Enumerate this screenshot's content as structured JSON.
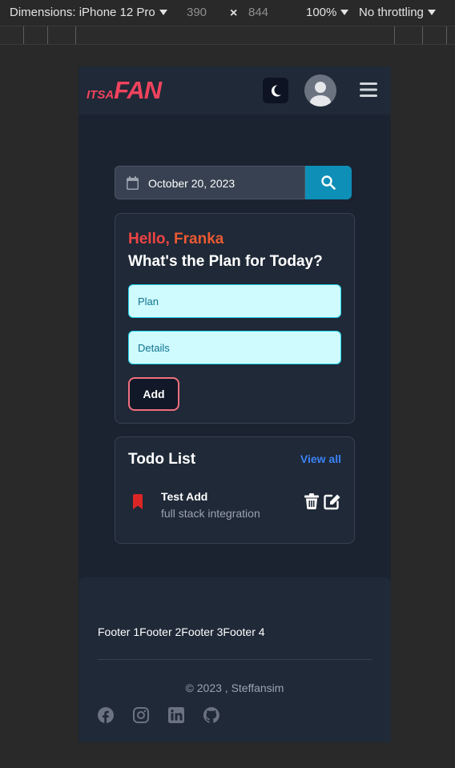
{
  "devtools": {
    "dimensions_label": "Dimensions: iPhone 12 Pro",
    "width": "390",
    "height": "844",
    "zoom": "100%",
    "throttling": "No throttling"
  },
  "navbar": {
    "logo_small": "ITSA",
    "logo_big": "FAN",
    "colors": {
      "brand": "#f0435e"
    }
  },
  "search": {
    "date_value": "October 20, 2023"
  },
  "plan_card": {
    "hello": "Hello,",
    "name": "Franka",
    "title": "What's the Plan for Today?",
    "plan_placeholder": "Plan",
    "details_placeholder": "Details",
    "add_label": "Add"
  },
  "todo": {
    "title": "Todo List",
    "view_all": "View all",
    "items": [
      {
        "title": "Test Add",
        "subtitle": "full stack integration"
      }
    ]
  },
  "footer": {
    "links": [
      "Footer 1",
      "Footer 2",
      "Footer 3",
      "Footer 4"
    ],
    "copyright": "© 2023 , Steffansim",
    "socials": [
      "facebook-icon",
      "instagram-icon",
      "linkedin-icon",
      "github-icon"
    ]
  }
}
